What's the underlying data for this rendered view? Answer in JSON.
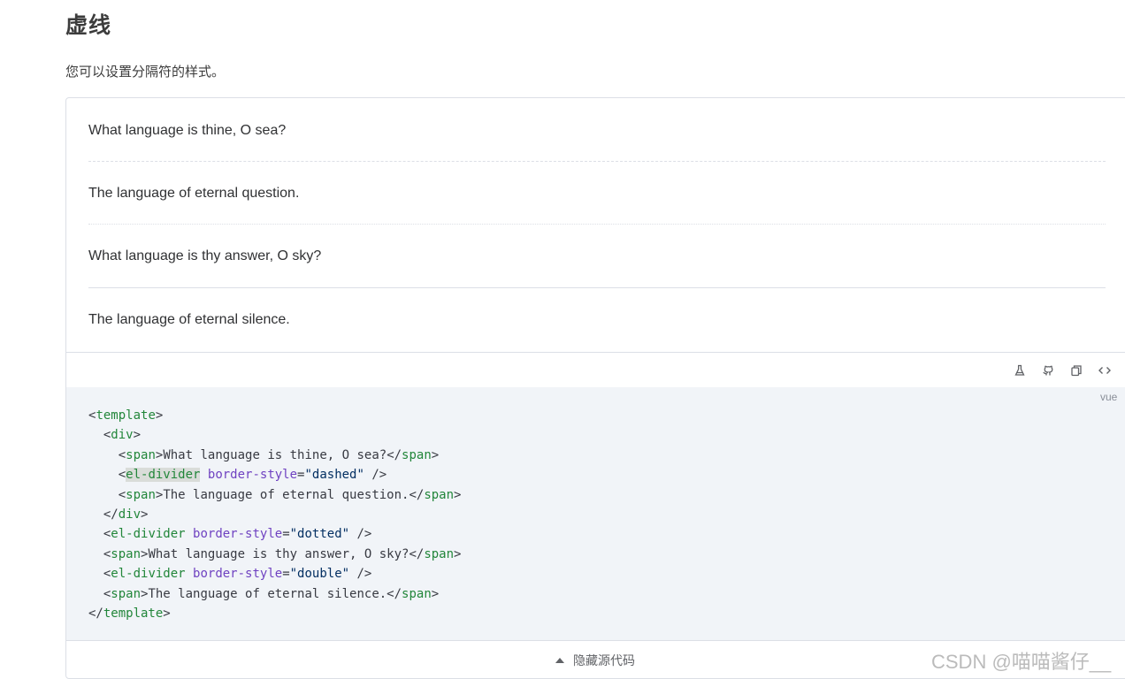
{
  "section": {
    "title": "虚线",
    "description": "您可以设置分隔符的样式。"
  },
  "preview": {
    "lines": [
      "What language is thine, O sea?",
      "The language of eternal question.",
      "What language is thy answer, O sky?",
      "The language of eternal silence."
    ],
    "dividers": [
      "dashed",
      "dotted",
      "double"
    ]
  },
  "toolbar": {
    "icons": [
      "flask-icon",
      "github-icon",
      "copy-icon",
      "code-icon"
    ]
  },
  "code": {
    "language": "vue",
    "tokens": {
      "template": "template",
      "div": "div",
      "span": "span",
      "el_divider": "el-divider",
      "border_style": "border-style",
      "dashed": "\"dashed\"",
      "dotted": "\"dotted\"",
      "double": "\"double\""
    },
    "texts": [
      "What language is thine, O sea?",
      "The language of eternal question.",
      "What language is thy answer, O sky?",
      "The language of eternal silence."
    ]
  },
  "footer": {
    "hide_label": "隐藏源代码"
  },
  "watermark": "CSDN @喵喵酱仔__"
}
